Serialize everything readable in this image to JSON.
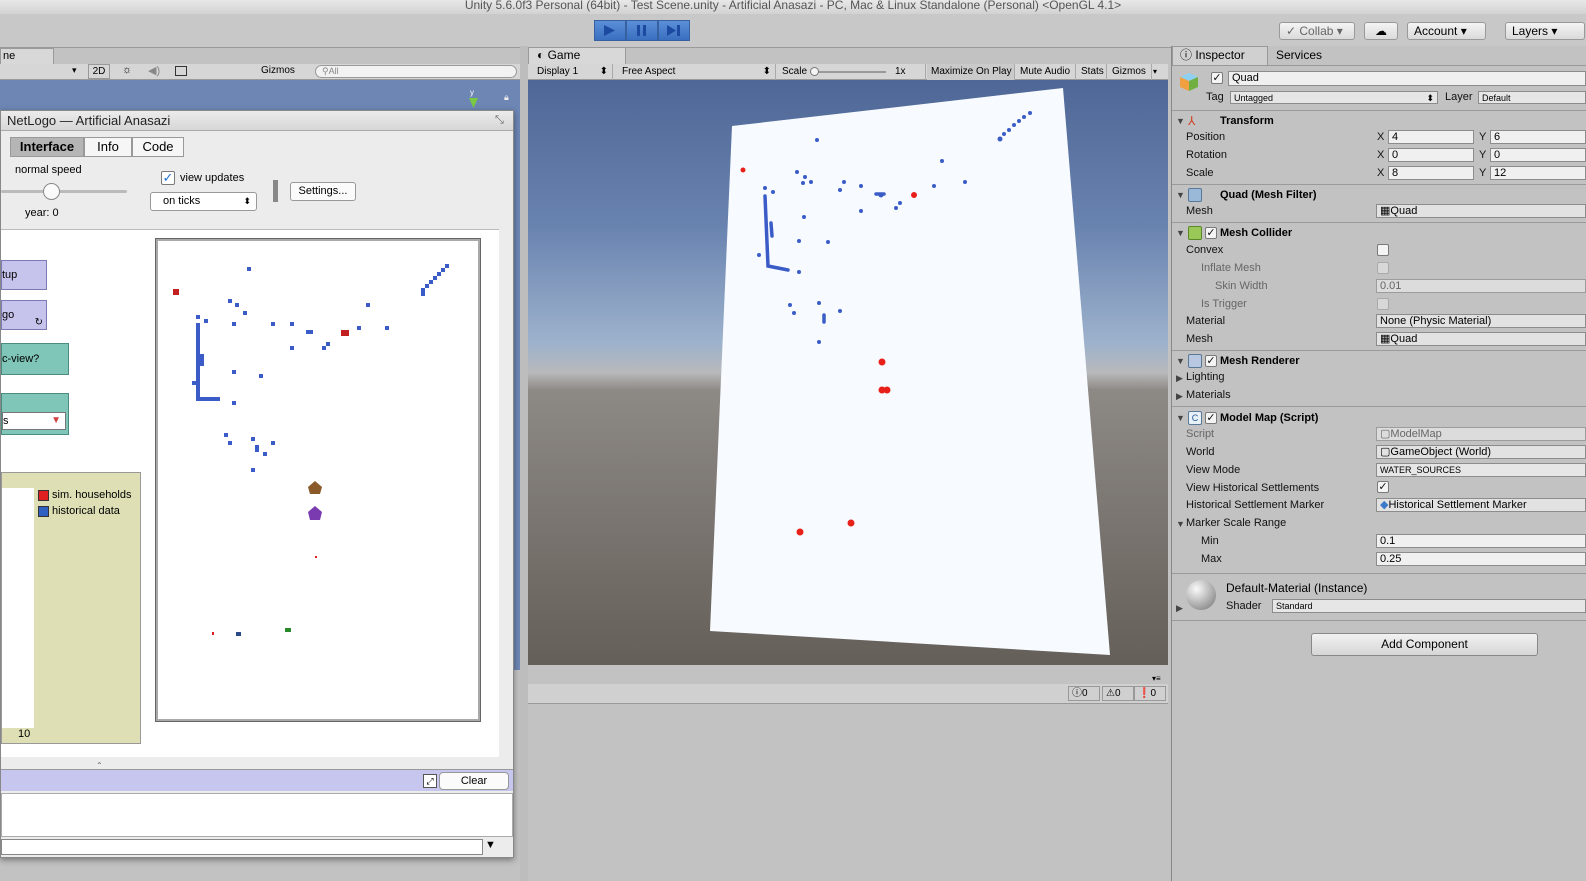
{
  "window": {
    "title": "Unity 5.6.0f3 Personal (64bit) - Test Scene.unity - Artificial Anasazi - PC, Mac & Linux Standalone (Personal) <OpenGL 4.1>"
  },
  "toolbar": {
    "collab": "Collab",
    "account": "Account",
    "layers": "Layers"
  },
  "scene": {
    "tab": "ne",
    "mode_2d": "2D",
    "gizmos": "Gizmos",
    "search_placeholder": "All",
    "axis": "y"
  },
  "netlogo": {
    "title": "NetLogo — Artificial Anasazi",
    "tabs": [
      "Interface",
      "Info",
      "Code"
    ],
    "speed_label": "normal speed",
    "year_label": "year: 0",
    "view_updates": "view updates",
    "update_mode": "on ticks",
    "settings": "Settings...",
    "buttons": [
      "tup",
      "go",
      "c-view?",
      "s"
    ],
    "legend": [
      "sim. households",
      "historical data"
    ],
    "plot_x_tick": "10",
    "clear": "Clear"
  },
  "game": {
    "tab": "Game",
    "display": "Display 1",
    "aspect": "Free Aspect",
    "scale_label": "Scale",
    "scale_value": "1x",
    "maximize": "Maximize On Play",
    "mute": "Mute Audio",
    "stats": "Stats",
    "gizmos": "Gizmos",
    "console_counts": [
      "0",
      "0",
      "0"
    ]
  },
  "inspector": {
    "tab": "Inspector",
    "services": "Services",
    "object_name": "Quad",
    "tag_label": "Tag",
    "tag": "Untagged",
    "layer_label": "Layer",
    "layer": "Default",
    "transform": {
      "title": "Transform",
      "rows": [
        {
          "label": "Position",
          "x": "4",
          "y": "6"
        },
        {
          "label": "Rotation",
          "x": "0",
          "y": "0"
        },
        {
          "label": "Scale",
          "x": "8",
          "y": "12"
        }
      ]
    },
    "mesh_filter": {
      "title": "Quad (Mesh Filter)",
      "mesh_label": "Mesh",
      "mesh": "Quad"
    },
    "mesh_collider": {
      "title": "Mesh Collider",
      "convex": "Convex",
      "inflate": "Inflate Mesh",
      "skin_width": "Skin Width",
      "skin_value": "0.01",
      "is_trigger": "Is Trigger",
      "material_label": "Material",
      "material": "None (Physic Material)",
      "mesh_label": "Mesh",
      "mesh": "Quad"
    },
    "mesh_renderer": {
      "title": "Mesh Renderer",
      "lighting": "Lighting",
      "materials": "Materials"
    },
    "model_map": {
      "title": "Model Map (Script)",
      "script_label": "Script",
      "script": "ModelMap",
      "world_label": "World",
      "world": "GameObject (World)",
      "view_mode_label": "View Mode",
      "view_mode": "WATER_SOURCES",
      "view_hist_label": "View Historical Settlements",
      "marker_label": "Historical Settlement Marker",
      "marker": "Historical Settlement Marker",
      "range_label": "Marker Scale Range",
      "min_label": "Min",
      "min": "0.1",
      "max_label": "Max",
      "max": "0.25"
    },
    "material": {
      "title": "Default-Material (Instance)",
      "shader_label": "Shader",
      "shader": "Standard"
    },
    "add_component": "Add Component"
  },
  "colors": {
    "blue_marks": "#3b5cc7",
    "red_marks": "#e8201a",
    "play_blue": "#3a6fc0"
  }
}
